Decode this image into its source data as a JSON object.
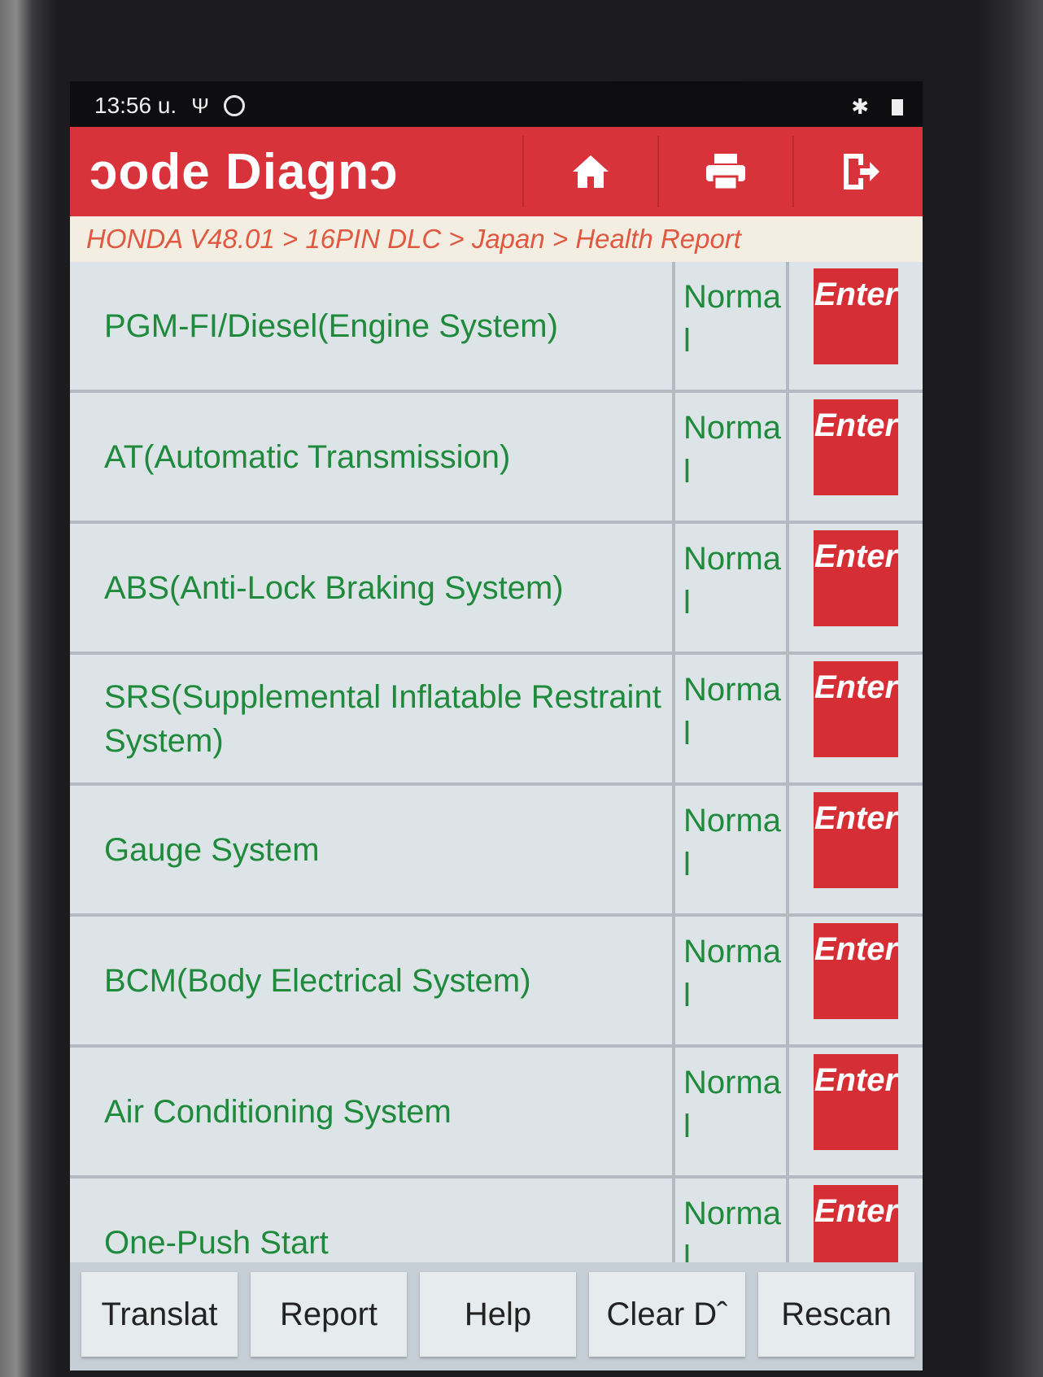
{
  "status_bar": {
    "time": "13:56 u.",
    "usb_glyph": "Ψ",
    "bluetooth_glyph": "✱"
  },
  "header": {
    "title": "Code Diagnosis",
    "title_visible": "ɔode       Diagnɔ",
    "icons": [
      "home-icon",
      "print-icon",
      "exit-icon"
    ]
  },
  "breadcrumb": "HONDA V48.01 > 16PIN DLC > Japan > Health Report",
  "systems": [
    {
      "name": "PGM-FI/Diesel(Engine System)",
      "status": "Normal",
      "action": "Enter"
    },
    {
      "name": "AT(Automatic Transmission)",
      "status": "Normal",
      "action": "Enter"
    },
    {
      "name": "ABS(Anti-Lock Braking System)",
      "status": "Normal",
      "action": "Enter"
    },
    {
      "name": "SRS(Supplemental Inflatable Restraint System)",
      "status": "Normal",
      "action": "Enter"
    },
    {
      "name": "Gauge System",
      "status": "Normal",
      "action": "Enter"
    },
    {
      "name": "BCM(Body Electrical System)",
      "status": "Normal",
      "action": "Enter"
    },
    {
      "name": "Air Conditioning System",
      "status": "Normal",
      "action": "Enter"
    },
    {
      "name": "One-Push Start",
      "status": "Normal",
      "action": "Enter"
    }
  ],
  "toolbar": {
    "translate": "Translat",
    "report": "Report",
    "help": "Help",
    "clear_dtc": "Clear Dˆ",
    "rescan": "Rescan"
  },
  "colors": {
    "header_red": "#d8333a",
    "system_green": "#1f8a3b",
    "breadcrumb_orange": "#e0583f",
    "row_bg": "#dde4e8"
  }
}
